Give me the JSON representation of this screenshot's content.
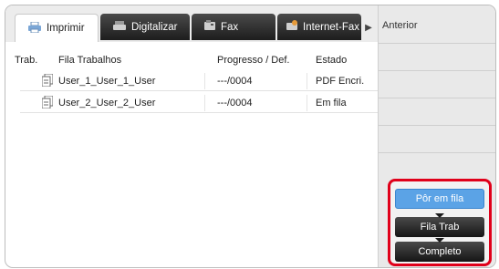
{
  "tabs": [
    {
      "label": "Imprimir",
      "icon": "printer-icon",
      "active": true
    },
    {
      "label": "Digitalizar",
      "icon": "scanner-icon",
      "active": false
    },
    {
      "label": "Fax",
      "icon": "fax-icon",
      "active": false
    },
    {
      "label": "Internet-Fax",
      "icon": "internet-fax-icon",
      "active": false
    }
  ],
  "side": {
    "previous_label": "Anterior"
  },
  "table": {
    "headers": {
      "trab": "Trab.",
      "fila": "Fila Trabalhos",
      "progresso": "Progresso / Def.",
      "estado": "Estado"
    },
    "rows": [
      {
        "name": "User_1_User_1_User",
        "progress": "---/0004",
        "status": "PDF Encri."
      },
      {
        "name": "User_2_User_2_User",
        "progress": "---/0004",
        "status": "Em fila"
      }
    ]
  },
  "actions": {
    "queue": "Pôr em fila",
    "job_queue": "Fila Trab",
    "complete": "Completo"
  },
  "colors": {
    "accent": "#5ba3e6",
    "highlight_border": "#e0001a",
    "tab_dark": "#2a2a2a"
  }
}
